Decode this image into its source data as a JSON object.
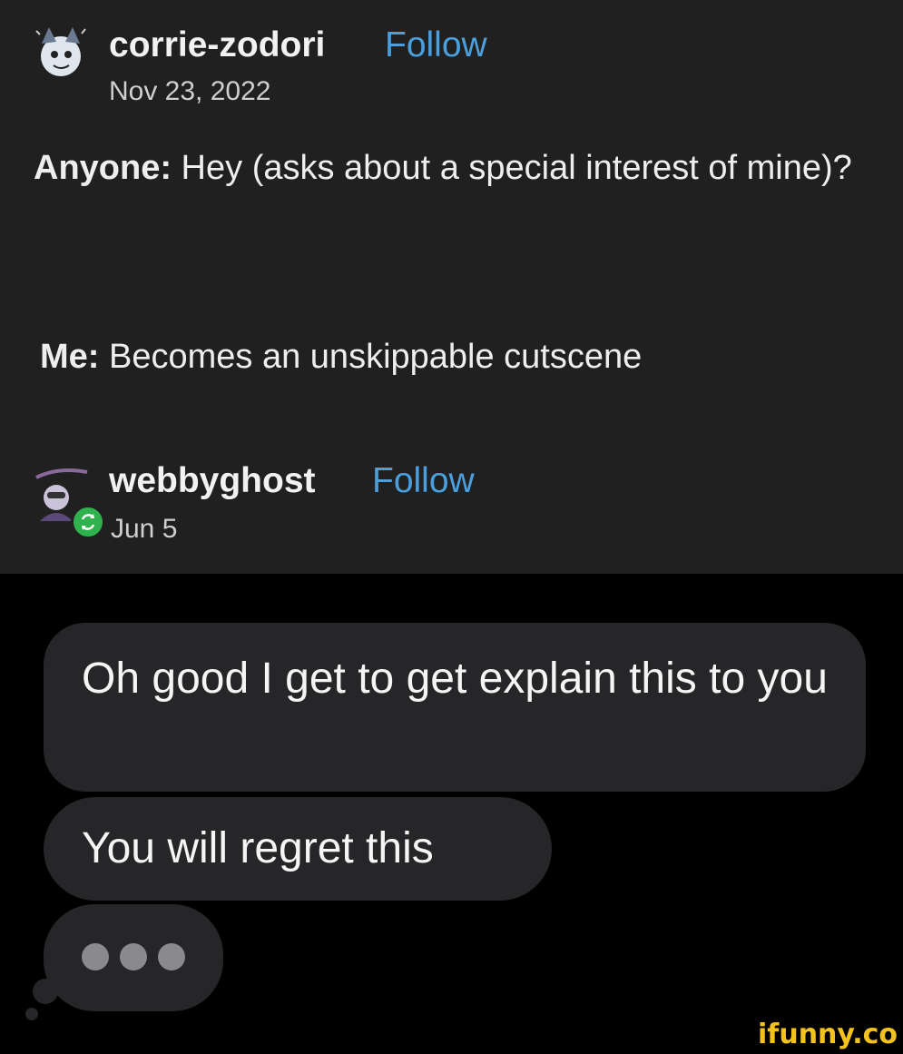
{
  "posts": [
    {
      "username": "corrie-zodori",
      "follow_label": "Follow",
      "date": "Nov 23, 2022",
      "avatar_icon": "corrie-zodori-avatar-icon",
      "body": [
        {
          "speaker": "Anyone:",
          "text": " Hey (asks about a special interest of mine)?"
        },
        {
          "speaker": "Me:",
          "text": " Becomes an unskippable cutscene"
        }
      ]
    },
    {
      "username": "webbyghost",
      "follow_label": "Follow",
      "date": "Jun 5",
      "avatar_icon": "webbyghost-avatar-icon",
      "badge_icon": "reblog-icon"
    }
  ],
  "messages": [
    {
      "text": "Oh good I get to get explain this to you"
    },
    {
      "text": "You will regret this"
    }
  ],
  "typing_indicator_icon": "typing-dots-icon",
  "watermark": "ifunny.co",
  "colors": {
    "post_background": "#202020",
    "chat_background": "#000000",
    "bubble": "#262629",
    "follow_link": "#4b9fdc",
    "reblog_badge": "#2fb24d",
    "watermark": "#f4c21c"
  }
}
